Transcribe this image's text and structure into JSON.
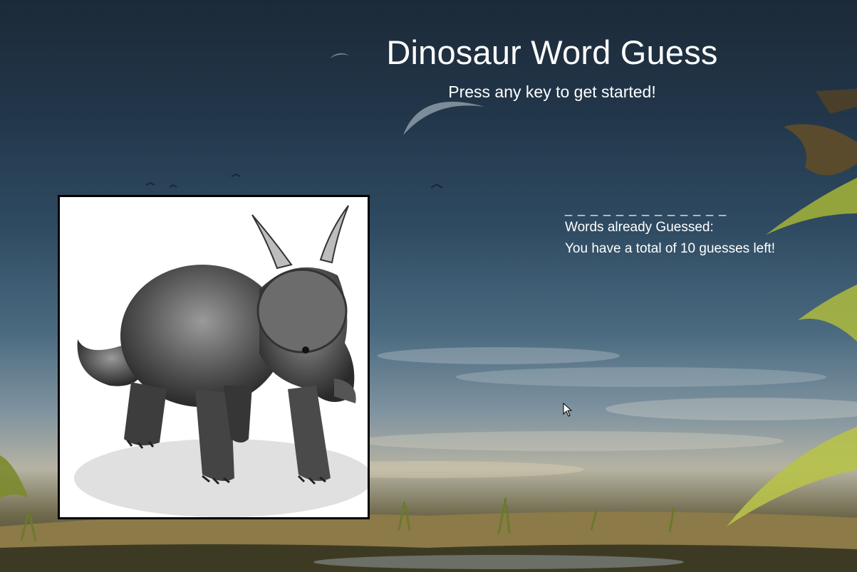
{
  "page": {
    "title": "Dinosaur Word Guess",
    "subtitle": "Press any key to get started!"
  },
  "game": {
    "word_blanks": "_ _ _ _ _ _ _ _ _ _ _ _ _",
    "guessed_label": "Words already Guessed:",
    "guesses_left_text": "You have a total of 10 guesses left!"
  },
  "image": {
    "subject": "horned dinosaur illustration"
  },
  "colors": {
    "text": "#ffffff",
    "frame_border": "#000000"
  }
}
